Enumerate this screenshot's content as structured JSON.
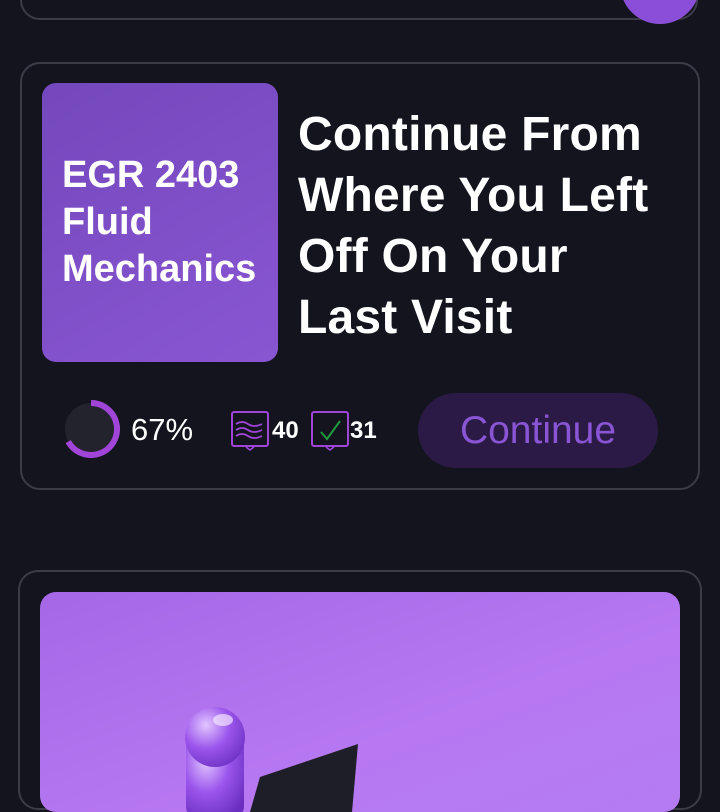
{
  "card": {
    "course_title": [
      "EGR 2403",
      "Fluid",
      "Mechanics"
    ],
    "heading": [
      "Continue From",
      "Where You Left",
      "Off On Your",
      "Last Visit"
    ],
    "progress": {
      "percent": 67,
      "label": "67%"
    },
    "stats": [
      {
        "icon": "lessons-icon",
        "value": "40"
      },
      {
        "icon": "completed-icon",
        "value": "31"
      }
    ],
    "continue_label": "Continue"
  },
  "colors": {
    "background": "#14141f",
    "accent": "#8a55d4",
    "tile": "#7a4cc6",
    "button_bg": "#2a1a45",
    "check": "#1e9b3a"
  }
}
